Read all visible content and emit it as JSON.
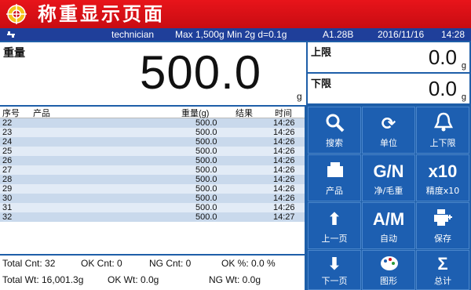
{
  "title": "称重显示页面",
  "status": {
    "user": "technician",
    "capacity": "Max 1,500g Min 2g d=0.1g",
    "version": "A1.28B",
    "date": "2016/11/16",
    "time": "14:28"
  },
  "weight": {
    "label": "重量",
    "value": "500.0",
    "unit": "g"
  },
  "upper_limit": {
    "label": "上限",
    "value": "0.0",
    "unit": "g"
  },
  "lower_limit": {
    "label": "下限",
    "value": "0.0",
    "unit": "g"
  },
  "table": {
    "headers": {
      "seq": "序号",
      "product": "产品",
      "weight": "重量(g)",
      "result": "结果",
      "time": "时间"
    },
    "rows": [
      {
        "seq": "22",
        "weight": "500.0",
        "time": "14:26"
      },
      {
        "seq": "23",
        "weight": "500.0",
        "time": "14:26"
      },
      {
        "seq": "24",
        "weight": "500.0",
        "time": "14:26"
      },
      {
        "seq": "25",
        "weight": "500.0",
        "time": "14:26"
      },
      {
        "seq": "26",
        "weight": "500.0",
        "time": "14:26"
      },
      {
        "seq": "27",
        "weight": "500.0",
        "time": "14:26"
      },
      {
        "seq": "28",
        "weight": "500.0",
        "time": "14:26"
      },
      {
        "seq": "29",
        "weight": "500.0",
        "time": "14:26"
      },
      {
        "seq": "30",
        "weight": "500.0",
        "time": "14:26"
      },
      {
        "seq": "31",
        "weight": "500.0",
        "time": "14:26"
      },
      {
        "seq": "32",
        "weight": "500.0",
        "time": "14:27"
      }
    ]
  },
  "totals": {
    "total_cnt": "Total Cnt: 32",
    "ok_cnt": "OK Cnt: 0",
    "ng_cnt": "NG Cnt: 0",
    "ok_pct": "OK %:   0.0 %",
    "total_wt": "Total Wt:  16,001.3g",
    "ok_wt": "OK Wt:      0.0g",
    "ng_wt": "NG Wt:      0.0g"
  },
  "buttons": {
    "search": {
      "label": "搜索",
      "icon": "magnifier-icon"
    },
    "unit": {
      "label": "单位",
      "icon": "refresh-arrows-icon"
    },
    "limits": {
      "label": "上下限",
      "icon": "bell-icon"
    },
    "product": {
      "label": "产品",
      "icon": "product-box-icon"
    },
    "gn": {
      "label": "净/毛重",
      "text": "G/N"
    },
    "x10": {
      "label": "精度x10",
      "text": "x10"
    },
    "page_up": {
      "label": "上一页",
      "icon": "arrow-up-icon"
    },
    "am": {
      "label": "自动",
      "text": "A/M"
    },
    "save": {
      "label": "保存",
      "icon": "printer-save-icon"
    },
    "page_down": {
      "label": "下一页",
      "icon": "arrow-down-icon"
    },
    "graph": {
      "label": "图形",
      "icon": "palette-icon"
    },
    "total": {
      "label": "总计",
      "text": "Σ"
    }
  },
  "colors": {
    "title_bar": "#d0101a",
    "button": "#1d5fb1",
    "status_bar": "#1f3f9a"
  }
}
